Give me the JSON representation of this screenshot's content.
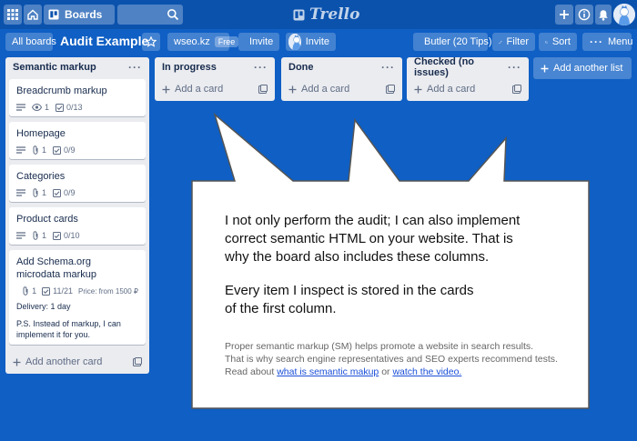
{
  "topbar": {
    "boards_label": "Boards",
    "search_value": "",
    "logo_text": "Trello"
  },
  "board": {
    "all_boards_label": "All boards",
    "title": "Audit Example",
    "workspace_label": "wseo.kz",
    "workspace_badge": "Free",
    "invite_label": "Invite",
    "invite2_label": "Invite",
    "butler_label": "Butler (20 Tips)",
    "filter_label": "Filter",
    "sort_label": "Sort",
    "menu_label": "Menu"
  },
  "lists": [
    {
      "title": "Semantic markup",
      "add_card_label": "Add another card",
      "cards": [
        {
          "title": "Breadcrumb markup",
          "views": "1",
          "checklist": "0/13"
        },
        {
          "title": "Homepage",
          "attachments": "1",
          "checklist": "0/9"
        },
        {
          "title": "Categories",
          "attachments": "1",
          "checklist": "0/9"
        },
        {
          "title": "Product cards",
          "attachments": "1",
          "checklist": "0/10"
        },
        {
          "title_line1": "Add Schema.org",
          "title_line2": "microdata markup",
          "attachments": "1",
          "checklist": "11/21",
          "price": "Price: from 1500 ₽",
          "delivery": "Delivery: 1 day",
          "note_line1": "P.S. Instead of markup, I can",
          "note_line2": "implement it for you."
        }
      ]
    },
    {
      "title": "In progress",
      "add_card_label": "Add a card"
    },
    {
      "title": "Done",
      "add_card_label": "Add a card"
    },
    {
      "title": "Checked (no issues)",
      "add_card_label": "Add a card"
    }
  ],
  "add_list_label": "Add another list",
  "callout": {
    "main_line1": "I not only perform the audit; I can also implement",
    "main_line2": "correct semantic HTML on your website. That is",
    "main_line3": "why the board also includes these columns.",
    "main_line4": "Every item I inspect is stored in the cards",
    "main_line5": "of the first column.",
    "small_line1": "Proper semantic markup (SM) helps promote a website in search results.",
    "small_line2": "That is why search engine representatives and SEO experts recommend tests.",
    "small_prefix": "Read about",
    "link1": "what is semantic makup",
    "small_mid": "or",
    "link2": "watch the video."
  },
  "colors": {
    "board_bg": "#0f5fc4",
    "topbar_bg": "#0b52ad",
    "list_bg": "#ebecf0",
    "link": "#1a4fd8"
  }
}
